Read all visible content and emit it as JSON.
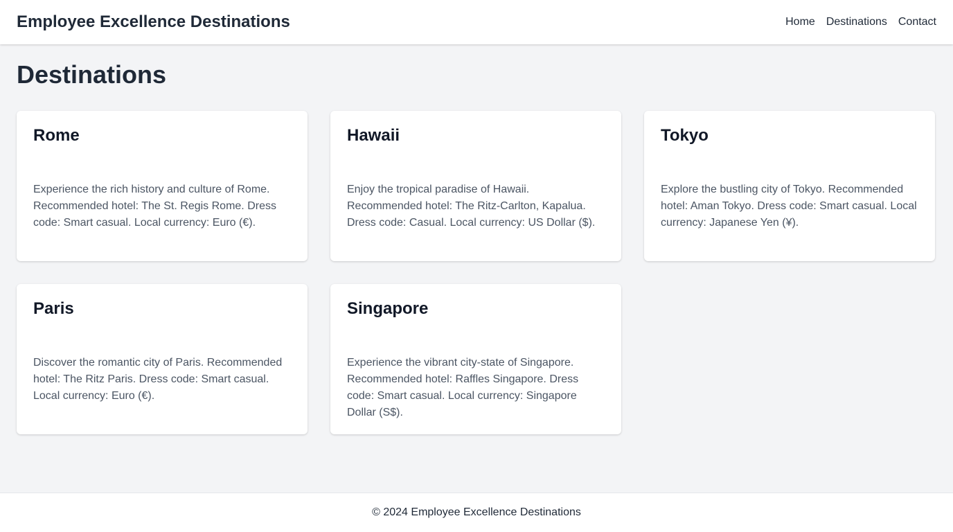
{
  "header": {
    "brand": "Employee Excellence Destinations",
    "nav": [
      "Home",
      "Destinations",
      "Contact"
    ]
  },
  "main": {
    "title": "Destinations",
    "destinations": [
      {
        "name": "Rome",
        "description": "Experience the rich history and culture of Rome. Recommended hotel: The St. Regis Rome. Dress code: Smart casual. Local currency: Euro (€)."
      },
      {
        "name": "Hawaii",
        "description": "Enjoy the tropical paradise of Hawaii. Recommended hotel: The Ritz-Carlton, Kapalua. Dress code: Casual. Local currency: US Dollar ($)."
      },
      {
        "name": "Tokyo",
        "description": "Explore the bustling city of Tokyo. Recommended hotel: Aman Tokyo. Dress code: Smart casual. Local currency: Japanese Yen (¥)."
      },
      {
        "name": "Paris",
        "description": "Discover the romantic city of Paris. Recommended hotel: The Ritz Paris. Dress code: Smart casual. Local currency: Euro (€)."
      },
      {
        "name": "Singapore",
        "description": "Experience the vibrant city-state of Singapore. Recommended hotel: Raffles Singapore. Dress code: Smart casual. Local currency: Singapore Dollar (S$)."
      }
    ]
  },
  "footer": {
    "text": "© 2024 Employee Excellence Destinations"
  },
  "colors": {
    "background": "#f3f4f6",
    "surface": "#ffffff",
    "text": "#1f2937",
    "muted": "#4b5563"
  }
}
